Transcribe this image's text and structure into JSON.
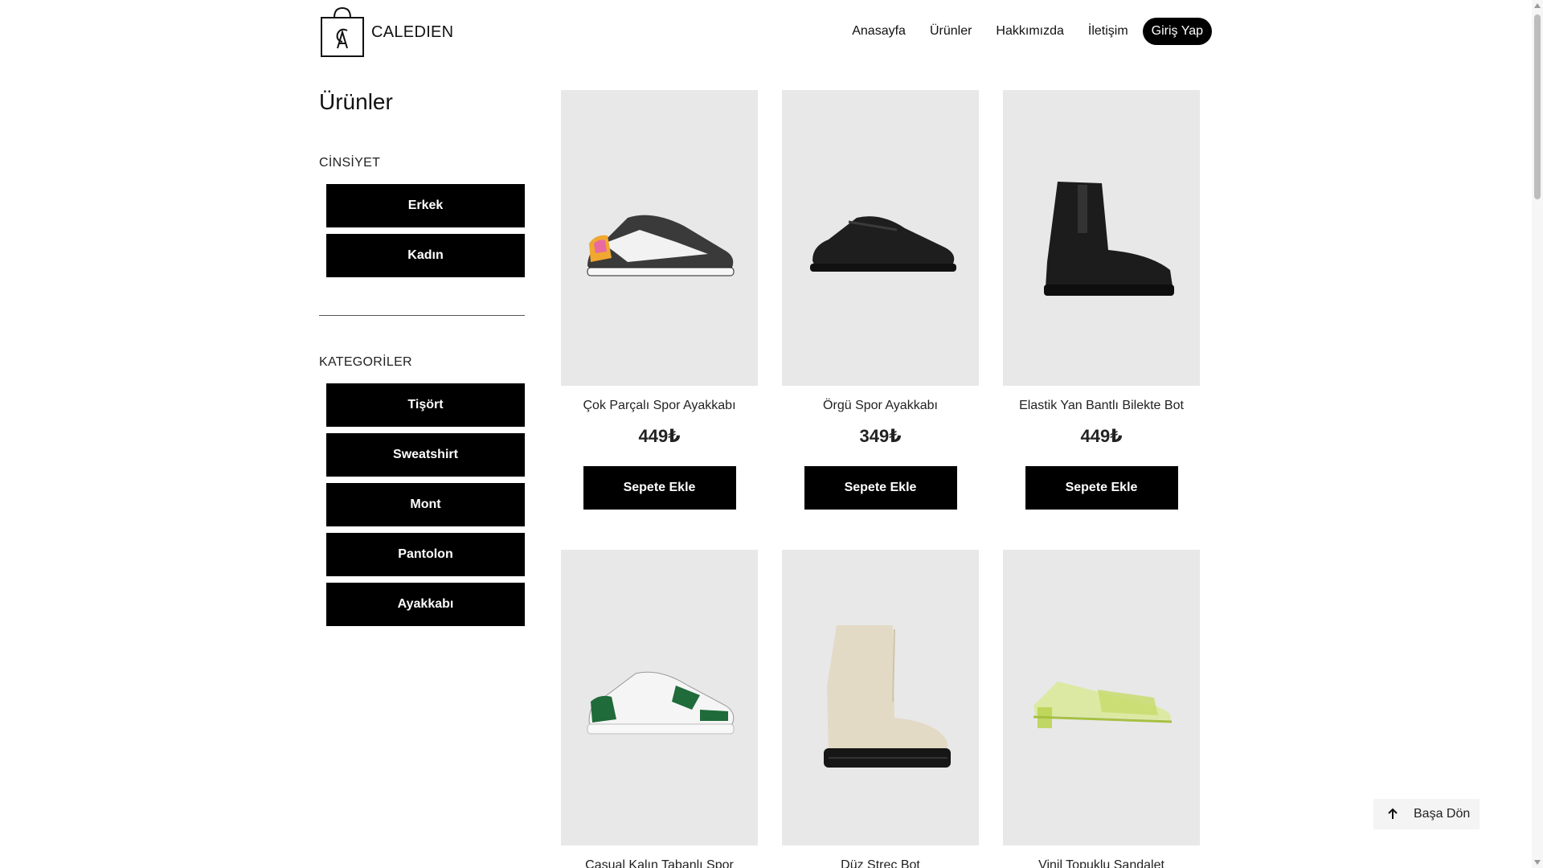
{
  "header": {
    "brand": "CALEDIEN",
    "nav": [
      "Anasayfa",
      "Ürünler",
      "Hakkımızda",
      "İletişim"
    ],
    "login": "Giriş Yap"
  },
  "sidebar": {
    "title": "Ürünler",
    "gender_label": "CİNSİYET",
    "genders": [
      "Erkek",
      "Kadın"
    ],
    "categories_label": "KATEGORİLER",
    "categories": [
      "Tişört",
      "Sweatshirt",
      "Mont",
      "Pantolon",
      "Ayakkabı"
    ]
  },
  "products": [
    {
      "name": "Çok Parçalı Spor Ayakkabı",
      "price": "449₺",
      "button": "Sepete Ekle",
      "icon": "sneaker-multicolor-icon"
    },
    {
      "name": "Örgü Spor Ayakkabı",
      "price": "349₺",
      "button": "Sepete Ekle",
      "icon": "sneaker-knit-black-icon"
    },
    {
      "name": "Elastik Yan Bantlı Bilekte Bot",
      "price": "449₺",
      "button": "Sepete Ekle",
      "icon": "chelsea-boot-black-icon"
    },
    {
      "name": "Casual Kalın Tabanlı Spor",
      "icon": "sneaker-green-white-icon"
    },
    {
      "name": "Düz Streç Bot",
      "icon": "boot-beige-icon"
    },
    {
      "name": "Vinil Topuklu Sandalet",
      "icon": "sandal-lime-icon"
    }
  ],
  "back_to_top": "Başa Dön",
  "colors": {
    "accent": "#000000",
    "card_bg": "#e8e8e8",
    "sandal": "#c8dc6e",
    "sneaker_green": "#1f6b3a"
  }
}
